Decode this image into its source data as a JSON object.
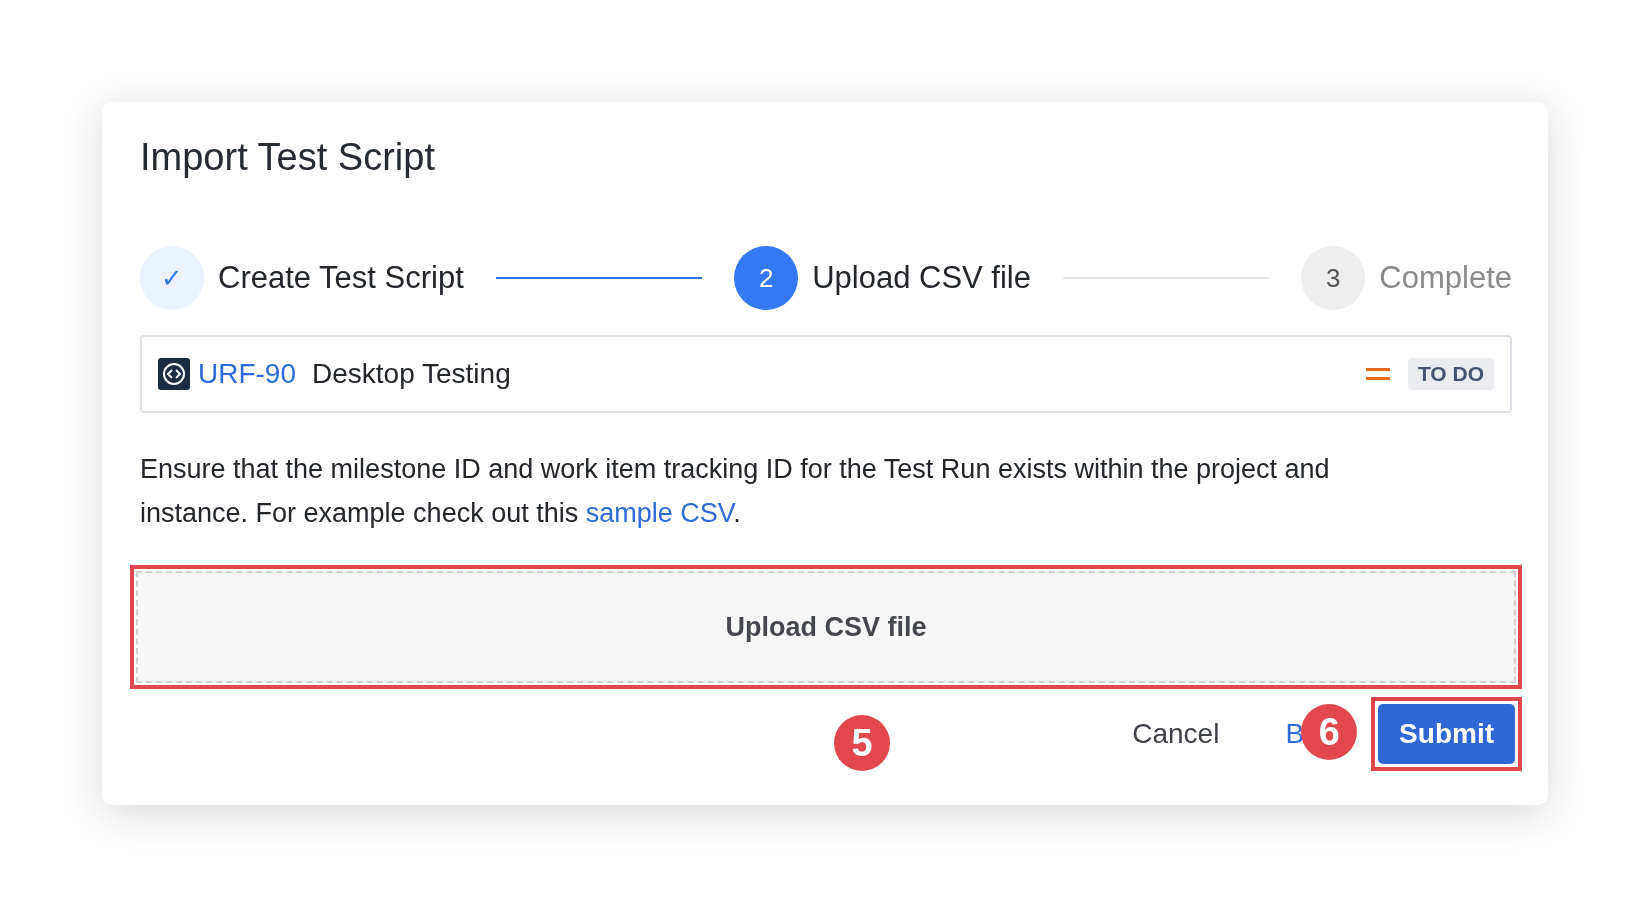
{
  "dialog": {
    "title": "Import Test Script"
  },
  "steps": [
    {
      "marker": "✓",
      "label": "Create Test Script",
      "completed": true,
      "selected": false
    },
    {
      "marker": "2",
      "label": "Upload CSV file",
      "completed": false,
      "selected": true
    },
    {
      "marker": "3",
      "label": "Complete",
      "completed": false,
      "selected": false
    }
  ],
  "issue": {
    "key": "URF-90",
    "summary": "Desktop Testing",
    "status": "TO DO"
  },
  "description": {
    "text": "Ensure that the milestone ID and work item tracking ID for the Test Run exists within the project and instance. For example check out this ",
    "link": "sample CSV",
    "after": "."
  },
  "upload": {
    "label": "Upload CSV file",
    "highlighted": true,
    "callout": "5"
  },
  "buttons": [
    {
      "kind": "subtle",
      "label": "Cancel",
      "highlighted": false
    },
    {
      "kind": "link",
      "label": "B",
      "highlighted": false,
      "callout": "6"
    },
    {
      "kind": "primary",
      "label": "Submit",
      "highlighted": true
    }
  ]
}
